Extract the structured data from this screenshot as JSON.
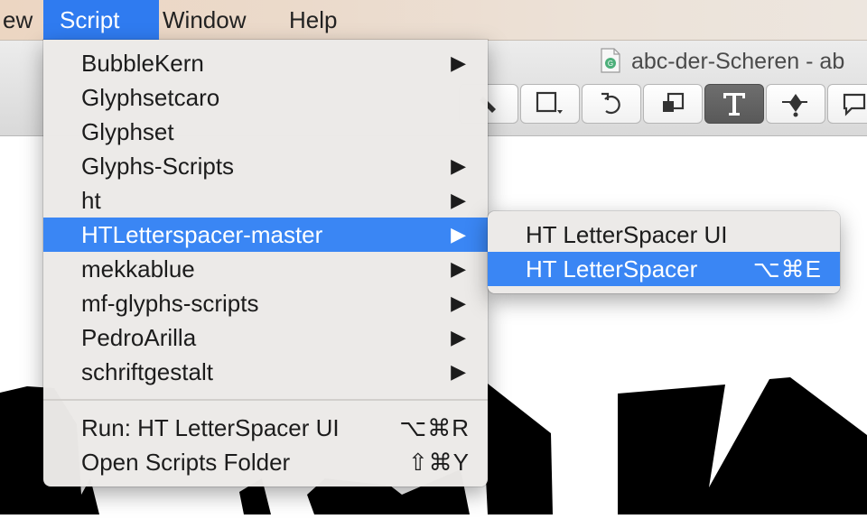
{
  "menubar": {
    "items": [
      "ew",
      "Script",
      "Window",
      "Help"
    ],
    "active": "Script"
  },
  "window": {
    "document_title": "abc-der-Scheren - ab",
    "document_icon": "glyphs-file-icon",
    "toolbar_icons": [
      "pencil-icon",
      "rectangle-tool-icon",
      "rotate-icon",
      "transform-icon",
      "text-tool-icon",
      "pen-tool-icon",
      "annotation-icon"
    ],
    "selected_tool": "text-tool-icon"
  },
  "script_menu": {
    "items": [
      {
        "label": "BubbleKern",
        "submenu": true
      },
      {
        "label": "Glyphsetcaro",
        "submenu": false
      },
      {
        "label": "Glyphset",
        "submenu": false
      },
      {
        "label": "Glyphs-Scripts",
        "submenu": true
      },
      {
        "label": "ht",
        "submenu": true
      },
      {
        "label": "HTLetterspacer-master",
        "submenu": true,
        "highlighted": true
      },
      {
        "label": "mekkablue",
        "submenu": true
      },
      {
        "label": "mf-glyphs-scripts",
        "submenu": true
      },
      {
        "label": "PedroArilla",
        "submenu": true
      },
      {
        "label": "schriftgestalt",
        "submenu": true
      }
    ],
    "commands": [
      {
        "label": "Run: HT LetterSpacer UI",
        "shortcut": "⌥⌘R"
      },
      {
        "label": "Open Scripts Folder",
        "shortcut": "⇧⌘Y"
      }
    ],
    "submenu_arrow": "▶"
  },
  "submenu": {
    "items": [
      {
        "label": "HT LetterSpacer UI",
        "shortcut": ""
      },
      {
        "label": "HT LetterSpacer",
        "shortcut": "⌥⌘E",
        "highlighted": true
      }
    ]
  },
  "colors": {
    "highlight": "#3a86f4",
    "menubar_active": "#2f7bf0"
  }
}
